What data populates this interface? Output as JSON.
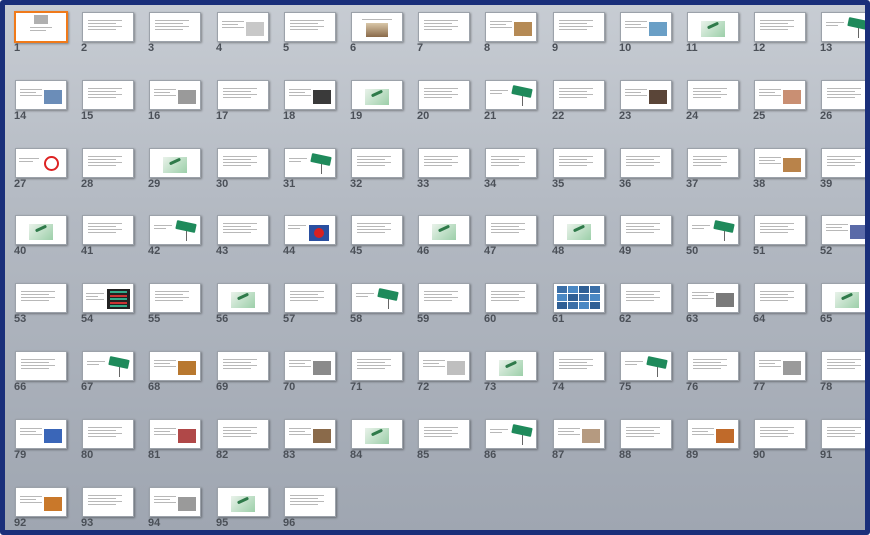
{
  "slides": [
    {
      "n": "1",
      "t": "",
      "k": "title"
    },
    {
      "n": "2",
      "t": "",
      "k": "text"
    },
    {
      "n": "3",
      "t": "",
      "k": "text"
    },
    {
      "n": "4",
      "t": "",
      "k": "text-image",
      "c": "#c8c8c8"
    },
    {
      "n": "5",
      "t": "",
      "k": "text"
    },
    {
      "n": "6",
      "t": "",
      "k": "scale"
    },
    {
      "n": "7",
      "t": "",
      "k": "text"
    },
    {
      "n": "8",
      "t": "",
      "k": "text-image",
      "c": "#b58a55"
    },
    {
      "n": "9",
      "t": "",
      "k": "text"
    },
    {
      "n": "10",
      "t": "",
      "k": "text-image",
      "c": "#6a9fc6"
    },
    {
      "n": "11",
      "t": "",
      "k": "question"
    },
    {
      "n": "12",
      "t": "",
      "k": "text"
    },
    {
      "n": "13",
      "t": "",
      "k": "sign"
    },
    {
      "n": "14",
      "t": "",
      "k": "text-image",
      "c": "#6b8db8"
    },
    {
      "n": "15",
      "t": "",
      "k": "text"
    },
    {
      "n": "16",
      "t": "",
      "k": "text-image",
      "c": "#9a9a9a"
    },
    {
      "n": "17",
      "t": "",
      "k": "text"
    },
    {
      "n": "18",
      "t": "",
      "k": "text-image",
      "c": "#3a3a3a"
    },
    {
      "n": "19",
      "t": "",
      "k": "question"
    },
    {
      "n": "20",
      "t": "",
      "k": "text"
    },
    {
      "n": "21",
      "t": "",
      "k": "sign"
    },
    {
      "n": "22",
      "t": "",
      "k": "text"
    },
    {
      "n": "23",
      "t": "",
      "k": "text-image",
      "c": "#5a4538"
    },
    {
      "n": "24",
      "t": "",
      "k": "text"
    },
    {
      "n": "25",
      "t": "",
      "k": "text-image",
      "c": "#c98f73"
    },
    {
      "n": "26",
      "t": "",
      "k": "text"
    },
    {
      "n": "27",
      "t": "",
      "k": "roadsign"
    },
    {
      "n": "28",
      "t": "",
      "k": "text"
    },
    {
      "n": "29",
      "t": "",
      "k": "question"
    },
    {
      "n": "30",
      "t": "",
      "k": "text"
    },
    {
      "n": "31",
      "t": "",
      "k": "sign"
    },
    {
      "n": "32",
      "t": "",
      "k": "text"
    },
    {
      "n": "33",
      "t": "",
      "k": "text"
    },
    {
      "n": "34",
      "t": "",
      "k": "text"
    },
    {
      "n": "35",
      "t": "",
      "k": "text"
    },
    {
      "n": "36",
      "t": "",
      "k": "text"
    },
    {
      "n": "37",
      "t": "",
      "k": "text"
    },
    {
      "n": "38",
      "t": "",
      "k": "text-image",
      "c": "#b9834a"
    },
    {
      "n": "39",
      "t": "",
      "k": "text"
    },
    {
      "n": "40",
      "t": "",
      "k": "question"
    },
    {
      "n": "41",
      "t": "",
      "k": "text"
    },
    {
      "n": "42",
      "t": "",
      "k": "sign"
    },
    {
      "n": "43",
      "t": "",
      "k": "text"
    },
    {
      "n": "44",
      "t": "",
      "k": "stop"
    },
    {
      "n": "45",
      "t": "",
      "k": "text"
    },
    {
      "n": "46",
      "t": "",
      "k": "question"
    },
    {
      "n": "47",
      "t": "",
      "k": "text"
    },
    {
      "n": "48",
      "t": "",
      "k": "question"
    },
    {
      "n": "49",
      "t": "",
      "k": "text"
    },
    {
      "n": "50",
      "t": "",
      "k": "sign"
    },
    {
      "n": "51",
      "t": "",
      "k": "text"
    },
    {
      "n": "52",
      "t": "",
      "k": "text-image",
      "c": "#5a6aa8"
    },
    {
      "n": "53",
      "t": "",
      "k": "text"
    },
    {
      "n": "54",
      "t": "",
      "k": "dark-image"
    },
    {
      "n": "55",
      "t": "",
      "k": "text"
    },
    {
      "n": "56",
      "t": "",
      "k": "question"
    },
    {
      "n": "57",
      "t": "",
      "k": "text"
    },
    {
      "n": "58",
      "t": "",
      "k": "sign"
    },
    {
      "n": "59",
      "t": "",
      "k": "text"
    },
    {
      "n": "60",
      "t": "",
      "k": "text"
    },
    {
      "n": "61",
      "t": "",
      "k": "photo-grid"
    },
    {
      "n": "62",
      "t": "",
      "k": "text"
    },
    {
      "n": "63",
      "t": "",
      "k": "text-image",
      "c": "#7a7a7a"
    },
    {
      "n": "64",
      "t": "",
      "k": "text"
    },
    {
      "n": "65",
      "t": "",
      "k": "question"
    },
    {
      "n": "66",
      "t": "",
      "k": "text"
    },
    {
      "n": "67",
      "t": "",
      "k": "sign"
    },
    {
      "n": "68",
      "t": "",
      "k": "text-image",
      "c": "#b8782f"
    },
    {
      "n": "69",
      "t": "",
      "k": "text"
    },
    {
      "n": "70",
      "t": "",
      "k": "text-image",
      "c": "#8a8a8a"
    },
    {
      "n": "71",
      "t": "",
      "k": "text"
    },
    {
      "n": "72",
      "t": "",
      "k": "text-image",
      "c": "#bfbfbf"
    },
    {
      "n": "73",
      "t": "",
      "k": "question"
    },
    {
      "n": "74",
      "t": "",
      "k": "text"
    },
    {
      "n": "75",
      "t": "",
      "k": "sign"
    },
    {
      "n": "76",
      "t": "",
      "k": "text"
    },
    {
      "n": "77",
      "t": "",
      "k": "text-image",
      "c": "#9a9a9a"
    },
    {
      "n": "78",
      "t": "",
      "k": "text"
    },
    {
      "n": "79",
      "t": "",
      "k": "text-image",
      "c": "#3a66b8"
    },
    {
      "n": "80",
      "t": "",
      "k": "text"
    },
    {
      "n": "81",
      "t": "",
      "k": "text-image",
      "c": "#b04848"
    },
    {
      "n": "82",
      "t": "",
      "k": "text"
    },
    {
      "n": "83",
      "t": "",
      "k": "text-image",
      "c": "#8a6a4a"
    },
    {
      "n": "84",
      "t": "",
      "k": "question"
    },
    {
      "n": "85",
      "t": "",
      "k": "text"
    },
    {
      "n": "86",
      "t": "",
      "k": "sign"
    },
    {
      "n": "87",
      "t": "",
      "k": "text-image",
      "c": "#b59a80"
    },
    {
      "n": "88",
      "t": "",
      "k": "text"
    },
    {
      "n": "89",
      "t": "",
      "k": "text-image",
      "c": "#c06a2a"
    },
    {
      "n": "90",
      "t": "",
      "k": "text"
    },
    {
      "n": "91",
      "t": "",
      "k": "text"
    },
    {
      "n": "92",
      "t": "",
      "k": "text-image",
      "c": "#c9782a"
    },
    {
      "n": "93",
      "t": "",
      "k": "text"
    },
    {
      "n": "94",
      "t": "",
      "k": "text-image",
      "c": "#9a9a9a"
    },
    {
      "n": "95",
      "t": "",
      "k": "question"
    },
    {
      "n": "96",
      "t": "",
      "k": "text"
    }
  ],
  "selected_slide": "1",
  "colors": {
    "selection": "#f07a1a",
    "frame_border": "#1a2f7a",
    "sign_green": "#1f8a5b"
  }
}
